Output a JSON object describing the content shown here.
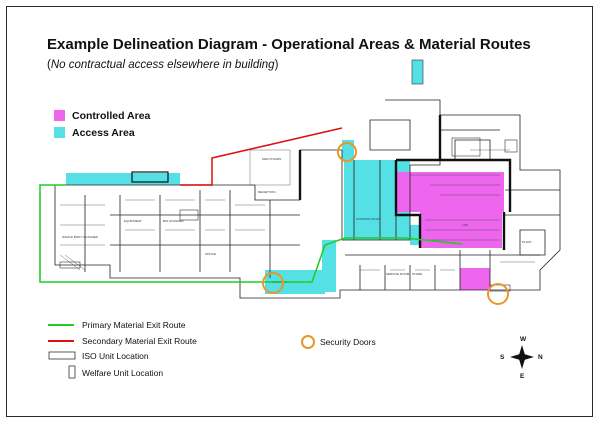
{
  "diagram": {
    "title": "Example Delineation Diagram - Operational Areas & Material Routes",
    "subtitle_open": "(",
    "subtitle_italic": "No contractual access elsewhere in building",
    "subtitle_close": ")"
  },
  "area_legend": [
    {
      "label": "Controlled Area",
      "color": "#ee66ee"
    },
    {
      "label": "Access Area",
      "color": "#55e0e6"
    }
  ],
  "key": {
    "primary_route": {
      "label": "Primary Material Exit Route",
      "color": "#22cc22"
    },
    "secondary_route": {
      "label": "Secondary Material Exit Route",
      "color": "#dd1111"
    },
    "iso_unit": {
      "label": "ISO Unit Location"
    },
    "welfare_unit": {
      "label": "Welfare Unit Location"
    },
    "security_doors": {
      "label": "Security Doors",
      "color": "#e8962a"
    }
  },
  "compass": {
    "n": "N",
    "s": "S",
    "e": "E",
    "w": "W"
  },
  "room_labels": [
    "EQUIPMENT",
    "BIO SCANNER",
    "RECEPTION",
    "MAIN STAIRS",
    "GOODS IN",
    "CONTROL ROOM",
    "SERVICE ROOM",
    "STORE",
    "WHOLE BODY SCANNER",
    "OFFICE",
    "PLANT",
    "LAB"
  ]
}
